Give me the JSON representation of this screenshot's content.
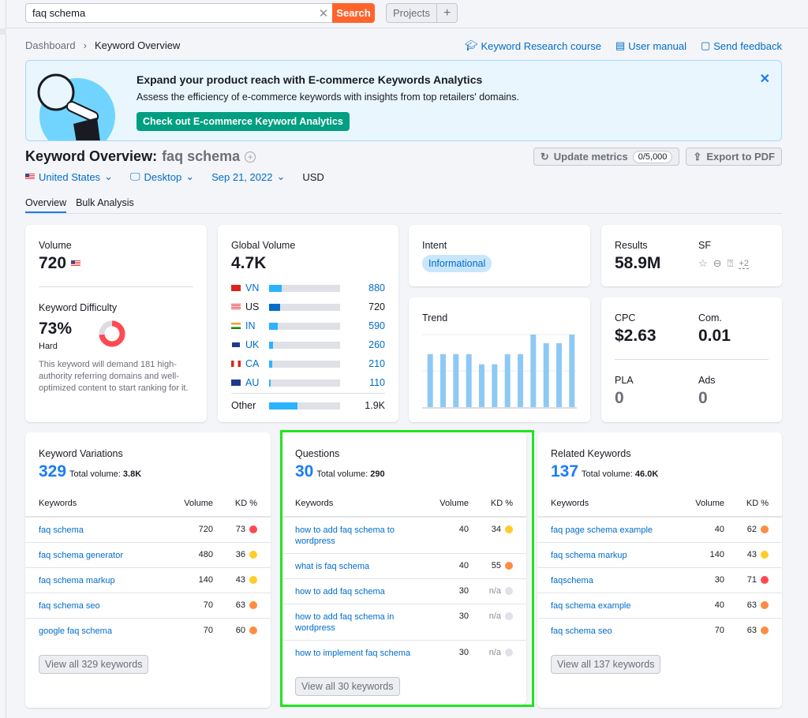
{
  "search": {
    "value": "faq schema",
    "button": "Search",
    "clear_icon": "close-icon"
  },
  "projects": {
    "label": "Projects",
    "add_icon": "plus-icon"
  },
  "breadcrumb": [
    "Dashboard",
    "Keyword Overview"
  ],
  "top_links": [
    {
      "icon": "graduation-cap-icon",
      "label": "Keyword Research course"
    },
    {
      "icon": "book-icon",
      "label": "User manual"
    },
    {
      "icon": "chat-icon",
      "label": "Send feedback"
    }
  ],
  "banner": {
    "title": "Expand your product reach with E-commerce Keywords Analytics",
    "text": "Assess the efficiency of e-commerce keywords with insights from top retailers' domains.",
    "cta": "Check out E-commerce Keyword Analytics",
    "colors": {
      "cta": "#009f81",
      "bg": "#e9f6fe"
    }
  },
  "header": {
    "title": "Keyword Overview:",
    "keyword": "faq schema",
    "country": "United States",
    "device": "Desktop",
    "date": "Sep 21, 2022",
    "currency": "USD",
    "update_metrics": "Update metrics",
    "update_count": "0/5,000",
    "export": "Export to PDF"
  },
  "tabs": [
    "Overview",
    "Bulk Analysis"
  ],
  "volume": {
    "label": "Volume",
    "value": "720"
  },
  "kd": {
    "label": "Keyword Difficulty",
    "value": "73%",
    "percent": 73,
    "level": "Hard",
    "desc": "This keyword will demand 181 high-authority referring domains and well-optimized content to start ranking for it.",
    "color": "#ff4953"
  },
  "global_volume": {
    "label": "Global Volume",
    "value": "4.7K",
    "countries": [
      {
        "code": "VN",
        "value": "880",
        "fraction": 0.18,
        "link": true
      },
      {
        "code": "US",
        "value": "720",
        "fraction": 0.15,
        "link": false
      },
      {
        "code": "IN",
        "value": "590",
        "fraction": 0.12,
        "link": true
      },
      {
        "code": "UK",
        "value": "260",
        "fraction": 0.05,
        "link": true
      },
      {
        "code": "CA",
        "value": "210",
        "fraction": 0.04,
        "link": true
      },
      {
        "code": "AU",
        "value": "110",
        "fraction": 0.02,
        "link": true
      }
    ],
    "other": {
      "label": "Other",
      "value": "1.9K",
      "fraction": 0.4
    }
  },
  "intent": {
    "label": "Intent",
    "value": "Informational"
  },
  "trend": {
    "label": "Trend",
    "values": [
      0.73,
      0.73,
      0.73,
      0.73,
      0.59,
      0.59,
      0.73,
      0.73,
      1.0,
      0.88,
      0.88,
      1.0
    ]
  },
  "results": {
    "label": "Results",
    "value": "58.9M",
    "sf_label": "SF",
    "sf_more": "+2",
    "sf_icons": [
      "star-icon",
      "link-icon",
      "question-box-icon"
    ]
  },
  "cpc": {
    "label": "CPC",
    "value": "$2.63"
  },
  "com": {
    "label": "Com.",
    "value": "0.01"
  },
  "pla": {
    "label": "PLA",
    "value": "0"
  },
  "ads": {
    "label": "Ads",
    "value": "0"
  },
  "kd_colors": {
    "red": "#ff4953",
    "orange": "#ff8c43",
    "yellow": "#ffcc29",
    "gray": "#e0e1e9"
  },
  "panels": [
    {
      "title": "Keyword Variations",
      "count": "329",
      "total_label": "Total volume:",
      "total": "3.8K",
      "col_kw": "Keywords",
      "col_vol": "Volume",
      "col_kd": "KD %",
      "rows": [
        {
          "kw": "faq schema",
          "vol": "720",
          "kd": "73",
          "c": "red"
        },
        {
          "kw": "faq schema generator",
          "vol": "480",
          "kd": "36",
          "c": "yellow"
        },
        {
          "kw": "faq schema markup",
          "vol": "140",
          "kd": "43",
          "c": "yellow"
        },
        {
          "kw": "faq schema seo",
          "vol": "70",
          "kd": "63",
          "c": "orange"
        },
        {
          "kw": "google faq schema",
          "vol": "70",
          "kd": "60",
          "c": "orange"
        }
      ],
      "view_all": "View all 329 keywords"
    },
    {
      "title": "Questions",
      "count": "30",
      "total_label": "Total volume:",
      "total": "290",
      "col_kw": "Keywords",
      "col_vol": "Volume",
      "col_kd": "KD %",
      "rows": [
        {
          "kw": "how to add faq schema to wordpress",
          "vol": "40",
          "kd": "34",
          "c": "yellow"
        },
        {
          "kw": "what is faq schema",
          "vol": "40",
          "kd": "55",
          "c": "orange"
        },
        {
          "kw": "how to add faq schema",
          "vol": "30",
          "kd": "n/a",
          "c": "gray"
        },
        {
          "kw": "how to add faq schema in wordpress",
          "vol": "30",
          "kd": "n/a",
          "c": "gray"
        },
        {
          "kw": "how to implement faq schema",
          "vol": "30",
          "kd": "n/a",
          "c": "gray"
        }
      ],
      "view_all": "View all 30 keywords"
    },
    {
      "title": "Related Keywords",
      "count": "137",
      "total_label": "Total volume:",
      "total": "46.0K",
      "col_kw": "Keywords",
      "col_vol": "Volume",
      "col_kd": "KD %",
      "rows": [
        {
          "kw": "faq page schema example",
          "vol": "40",
          "kd": "62",
          "c": "orange"
        },
        {
          "kw": "faq schema markup",
          "vol": "140",
          "kd": "43",
          "c": "yellow"
        },
        {
          "kw": "faqschema",
          "vol": "30",
          "kd": "71",
          "c": "red"
        },
        {
          "kw": "faq schema example",
          "vol": "40",
          "kd": "63",
          "c": "orange"
        },
        {
          "kw": "faq schema seo",
          "vol": "70",
          "kd": "63",
          "c": "orange"
        }
      ],
      "view_all": "View all 137 keywords"
    }
  ]
}
